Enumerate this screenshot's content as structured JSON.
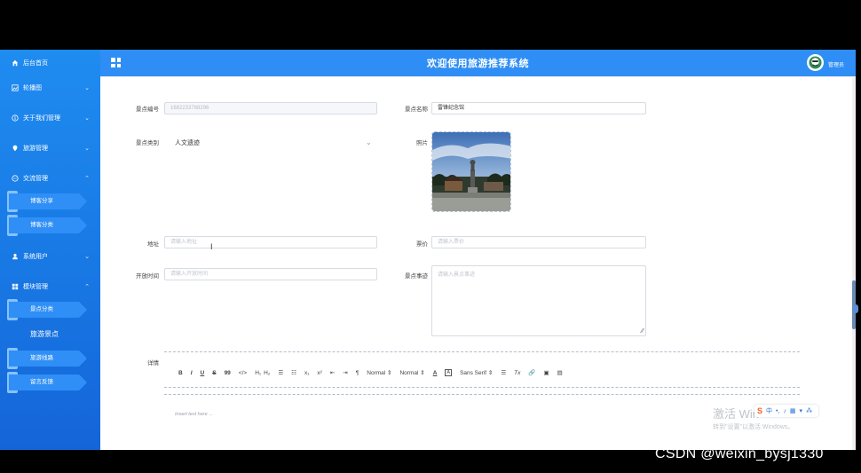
{
  "header": {
    "title": "欢迎使用旅游推荐系统",
    "admin": "管理员"
  },
  "sidebar": {
    "items": [
      {
        "label": "后台首页",
        "icon": "home-icon"
      },
      {
        "label": "轮播图",
        "icon": "image-icon"
      },
      {
        "label": "关于我们管理",
        "icon": "info-icon"
      },
      {
        "label": "旅游管理",
        "icon": "pin-icon"
      },
      {
        "label": "交流管理",
        "icon": "chat-icon"
      },
      {
        "label": "系统用户",
        "icon": "user-icon"
      },
      {
        "label": "模块管理",
        "icon": "grid-icon"
      }
    ],
    "sub_exchange": [
      "博客分享",
      "博客分类"
    ],
    "sub_modules": [
      "景点分类",
      "旅游景点",
      "旅游线路",
      "留言反馈"
    ]
  },
  "form": {
    "spot_no_label": "景点编号",
    "spot_no_value": "1682233768296",
    "spot_name_label": "景点名称",
    "spot_name_value": "雷锋纪念馆",
    "category_label": "景点类别",
    "category_value": "人文遗迹",
    "photo_label": "照片",
    "address_label": "地址",
    "address_placeholder": "请输入地址",
    "price_label": "票价",
    "price_placeholder": "请输入票价",
    "open_label": "开放时间",
    "open_placeholder": "请输入开放时间",
    "story_label": "景点事迹",
    "story_placeholder": "请输入景点事迹",
    "detail_label": "详情",
    "editor_placeholder": "Insert text here ..."
  },
  "toolbar": {
    "bold": "B",
    "italic": "I",
    "underline": "U",
    "strike": "S",
    "quote": "99",
    "code": "</>",
    "h1": "H₁",
    "h2": "H₂",
    "ol": "☰",
    "ul": "☷",
    "sub": "x₁",
    "sup": "x²",
    "outdent": "⇤",
    "indent": "⇥",
    "rtl": "¶",
    "size": "Normal",
    "header": "Normal",
    "color": "A",
    "bg": "A",
    "font": "Sans Serif",
    "align": "☰",
    "clean": "Tx",
    "link": "🔗",
    "image": "▣",
    "video": "▤"
  },
  "watermark": {
    "line1": "激活 Win",
    "line2": "转到\"设置\"以激活 Windows。"
  },
  "ime": {
    "lang": "中"
  },
  "csdn": "CSDN @weixin_bysj1330",
  "colors": {
    "sidebar": "#1a7ee8",
    "header": "#2f8ef5",
    "ime_brand": "#ff5a1f"
  }
}
